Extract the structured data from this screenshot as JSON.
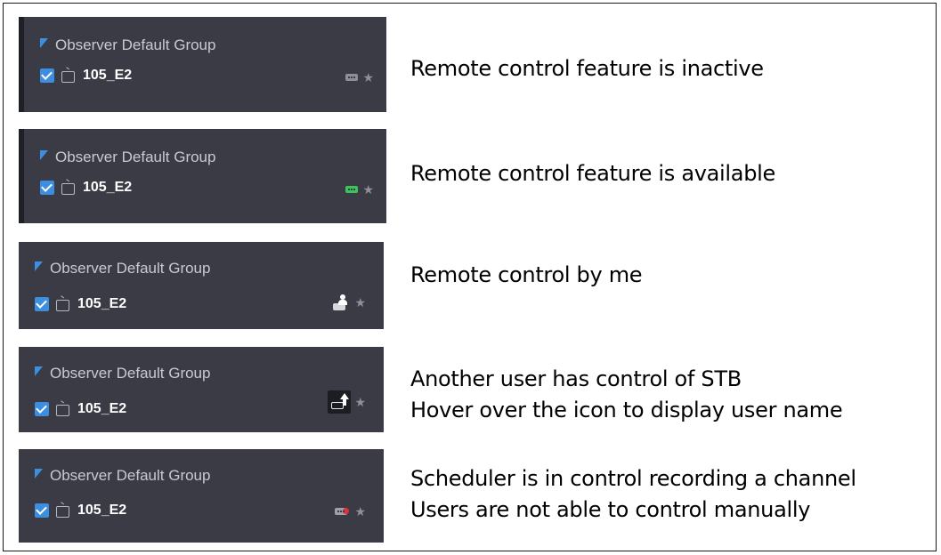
{
  "rows": [
    {
      "group": "Observer Default Group",
      "device": "105_E2",
      "status_icon": "remote-inactive-icon",
      "caption_lines": [
        "Remote control feature is inactive"
      ]
    },
    {
      "group": "Observer Default Group",
      "device": "105_E2",
      "status_icon": "remote-available-icon",
      "status_color": "#3cc35a",
      "caption_lines": [
        "Remote control feature is available"
      ]
    },
    {
      "group": "Observer Default Group",
      "device": "105_E2",
      "status_icon": "remote-by-me-icon",
      "caption_lines": [
        "Remote control by me"
      ]
    },
    {
      "group": "Observer Default Group",
      "device": "105_E2",
      "status_icon": "remote-other-user-icon",
      "caption_lines": [
        "Another user has control of STB",
        "Hover over the icon to display user name"
      ]
    },
    {
      "group": "Observer Default Group",
      "device": "105_E2",
      "status_icon": "remote-scheduler-recording-icon",
      "status_color": "#e0303a",
      "caption_lines": [
        "Scheduler is in control recording a channel",
        "Users are not able to control manually"
      ]
    }
  ],
  "colors": {
    "panel": "#3a3b45",
    "accent": "#3b8ee0"
  }
}
